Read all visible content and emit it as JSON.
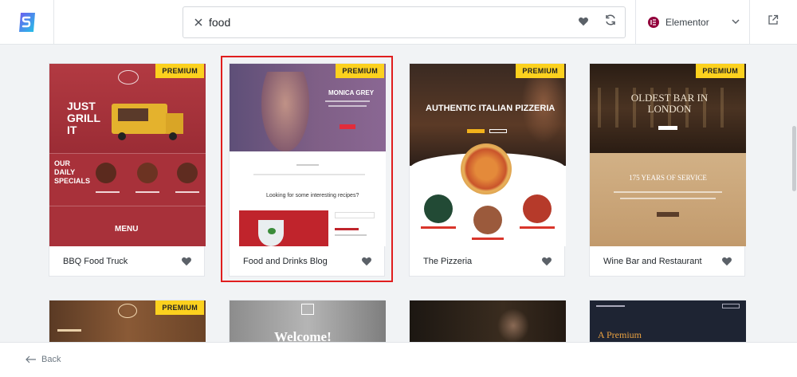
{
  "header": {
    "logo_icon": "starter-templates-logo-icon",
    "search": {
      "value": "food",
      "placeholder": ""
    },
    "builder": {
      "label": "Elementor",
      "brand_color": "#92003b"
    }
  },
  "accent": {
    "premium_bg": "#fcd11e",
    "selection_border": "#e01e1e"
  },
  "templates_row1": [
    {
      "title": "BBQ Food Truck",
      "badge": "PREMIUM"
    },
    {
      "title": "Food and Drinks Blog",
      "badge": "PREMIUM",
      "selected": true
    },
    {
      "title": "The Pizzeria",
      "badge": "PREMIUM"
    },
    {
      "title": "Wine Bar and Restaurant",
      "badge": "PREMIUM"
    }
  ],
  "templates_row2": [
    {
      "badge": "PREMIUM"
    },
    {
      "badge": ""
    },
    {
      "badge": ""
    },
    {
      "badge": ""
    }
  ],
  "thumbs": {
    "bbq_headline": "JUST GRILL IT",
    "bbq_specials": "OUR DAILY SPECIALS",
    "bbq_menu": "MENU",
    "blog_name": "MONICA GREY",
    "blog_recipes": "Looking for some interesting recipes?",
    "pizza_headline": "AUTHENTIC ITALIAN PIZZERIA",
    "wine_headline": "OLDEST BAR IN LONDON",
    "wine_sub": "175 YEARS OF SERVICE",
    "row2_welcome": "Welcome!",
    "row2_premium": "A Premium"
  },
  "footer": {
    "back_label": "Back"
  }
}
